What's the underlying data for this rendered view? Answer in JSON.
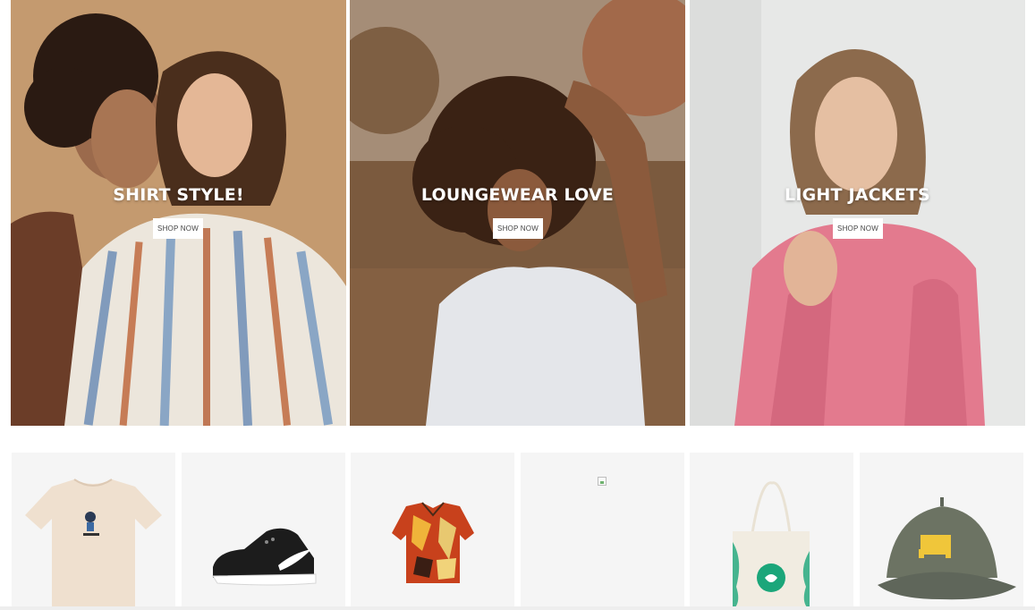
{
  "hero_tiles": [
    {
      "title": "SHIRT STYLE!",
      "button_label": "SHOP NOW"
    },
    {
      "title": "LOUNGEWEAR LOVE",
      "button_label": "SHOP NOW"
    },
    {
      "title": "LIGHT JACKETS",
      "button_label": "SHOP NOW"
    }
  ],
  "products": [
    {
      "image": "cream-graphic-tshirt"
    },
    {
      "image": "black-white-sneaker"
    },
    {
      "image": "patterned-camp-shirt"
    },
    {
      "image": "broken-image"
    },
    {
      "image": "canvas-tote-bag"
    },
    {
      "image": "gray-cap-yellow-dog"
    }
  ],
  "colors": {
    "hero_1_bg": "#c49a6c",
    "hero_2_bg": "#8a6a4a",
    "hero_3_bg": "#e6e7e6",
    "jacket_pink": "#e37a8e",
    "card_bg": "#f5f5f5"
  }
}
